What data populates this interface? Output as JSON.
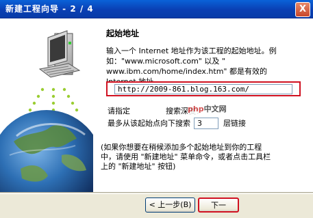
{
  "window": {
    "title": "新建工程向导 - 2 / 4",
    "close_label": "X"
  },
  "main": {
    "heading": "起始地址",
    "description_lines": [
      "输入一个 Internet 地址作为该工程的起始地址。例",
      "如：\"www.microsoft.com\" 以及 \"",
      "www.ibm.com/home/index.htm\" 都是有效的",
      "Internet 地址。"
    ],
    "url_value": "http://2009-861.blog.163.com/",
    "depth_label_start": "请指定",
    "depth_label_end": "搜索深度：",
    "depth_prefix": "最多从该起始点向下搜索",
    "depth_value": "3",
    "depth_suffix": "层链接",
    "note_lines": [
      "(如果你想要在稍候添加多个起始地址到你的工程",
      "中，请使用 \"新建地址\" 菜单命令，或者点击工具栏",
      "上的 \"新建地址\" 按钮)"
    ]
  },
  "watermark": {
    "brand_a": "php",
    "brand_b": "中文网"
  },
  "footer": {
    "back_label": "< 上一步(B)",
    "next_label": "下一"
  },
  "icons": {
    "computer": "computer-icon",
    "globe": "globe-icon"
  },
  "colors": {
    "title_bar": "#0a3fb3",
    "highlight_border": "#d01020",
    "dialog_bg": "#ece9d8"
  }
}
